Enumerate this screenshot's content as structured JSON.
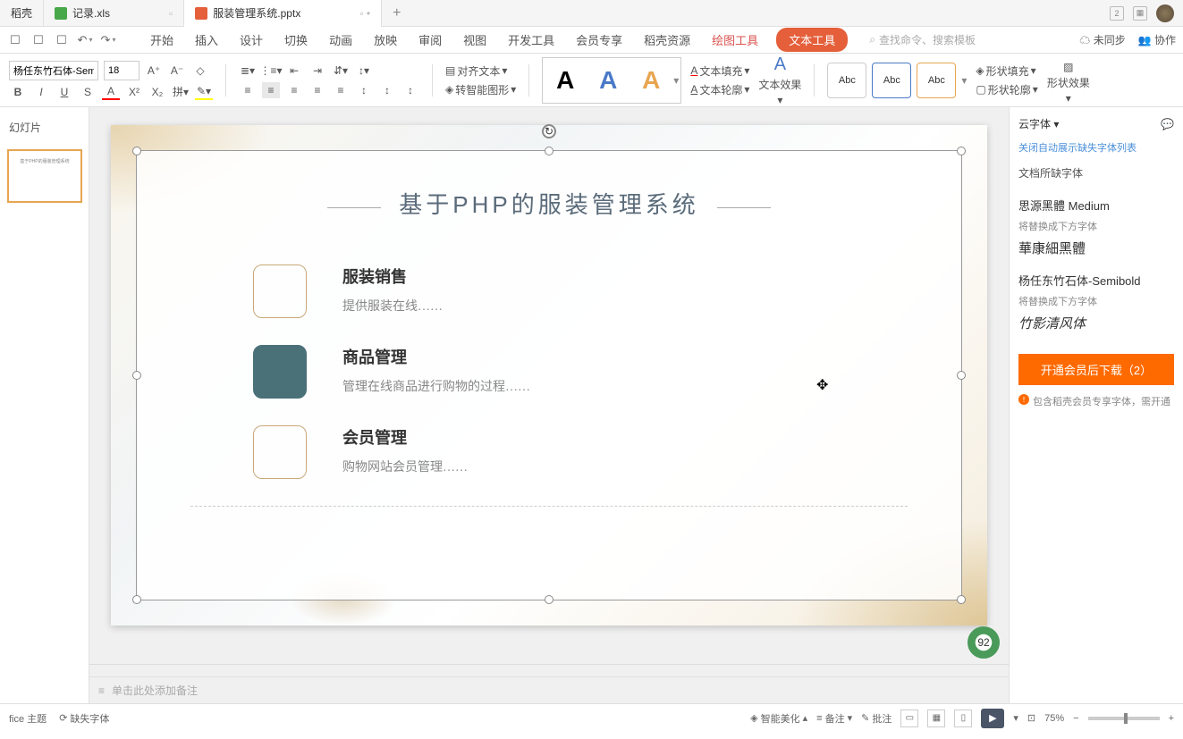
{
  "tabs": {
    "t1": "稻壳",
    "t2": "记录.xls",
    "t3": "服装管理系统.pptx",
    "badge": "2"
  },
  "menus": {
    "start": "开始",
    "insert": "插入",
    "design": "设计",
    "transition": "切换",
    "animation": "动画",
    "slideshow": "放映",
    "review": "审阅",
    "view": "视图",
    "devtools": "开发工具",
    "member": "会员专享",
    "docer": "稻壳资源",
    "drawing": "绘图工具",
    "texttool": "文本工具"
  },
  "search": {
    "placeholder": "查找命令、搜索模板"
  },
  "sync": {
    "unsync": "未同步",
    "collab": "协作"
  },
  "ribbon": {
    "font": "杨任东竹石体-Sem",
    "size": "18",
    "align_text": "对齐文本",
    "smart_graphic": "转智能图形",
    "text_fill": "文本填充",
    "text_outline": "文本轮廓",
    "text_effect": "文本效果",
    "abc": "Abc",
    "shape_fill": "形状填充",
    "shape_outline": "形状轮廓",
    "shape_effect": "形状效果"
  },
  "leftpane": {
    "slides": "幻灯片"
  },
  "slide": {
    "title": "基于PHP的服装管理系统",
    "items": [
      {
        "title": "服装销售",
        "desc": "提供服装在线……"
      },
      {
        "title": "商品管理",
        "desc": "管理在线商品进行购物的过程……"
      },
      {
        "title": "会员管理",
        "desc": "购物网站会员管理……"
      }
    ]
  },
  "rightpane": {
    "cloud_font": "云字体",
    "link": "关闭自动展示缺失字体列表",
    "section": "文档所缺字体",
    "font1": {
      "name": "思源黑體 Medium",
      "replace": "将替换成下方字体",
      "sample": "華康細黑體"
    },
    "font2": {
      "name": "杨任东竹石体-Semibold",
      "replace": "将替换成下方字体",
      "sample": "竹影清风体"
    },
    "button": "开通会员后下载（2）",
    "note": "包含稻壳会员专享字体，需开通"
  },
  "notes": {
    "placeholder": "单击此处添加备注"
  },
  "status": {
    "theme": "fice 主题",
    "missing_font": "缺失字体",
    "beautify": "智能美化",
    "remark": "备注",
    "comment": "批注",
    "zoom": "75%",
    "perf": "92"
  }
}
